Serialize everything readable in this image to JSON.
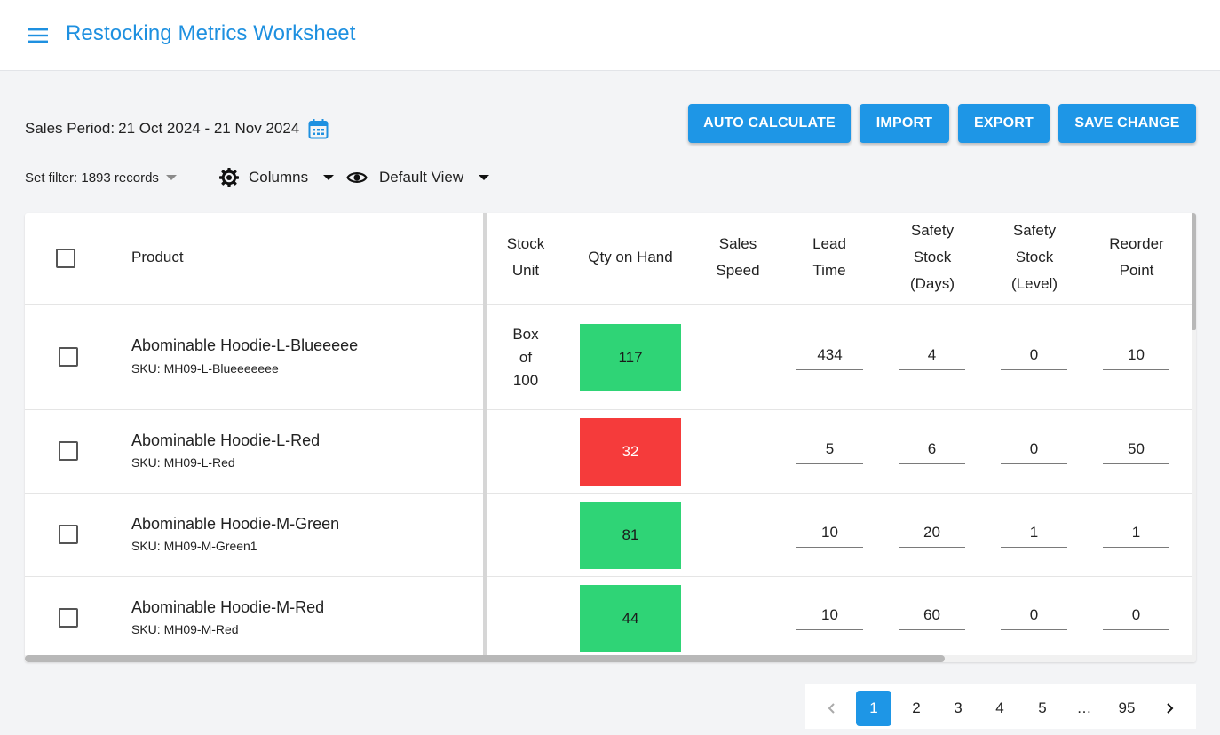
{
  "header": {
    "title": "Restocking Metrics Worksheet",
    "menu_icon": "menu-icon"
  },
  "sales_period": {
    "label": "Sales Period:",
    "value": "21 Oct 2024 - 21 Nov 2024",
    "icon": "calendar-icon"
  },
  "toolbar": {
    "auto_calculate": "AUTO CALCULATE",
    "import": "IMPORT",
    "export": "EXPORT",
    "save_change": "SAVE CHANGE"
  },
  "filters": {
    "set_filter": "Set filter: 1893 records",
    "columns": "Columns",
    "view": "Default View"
  },
  "table": {
    "headers": {
      "product": "Product",
      "stock_unit": [
        "Stock",
        "Unit"
      ],
      "qty_on_hand": "Qty on Hand",
      "sales_speed": [
        "Sales",
        "Speed"
      ],
      "lead_time": [
        "Lead",
        "Time"
      ],
      "safety_days": [
        "Safety",
        "Stock",
        "(Days)"
      ],
      "safety_level": [
        "Safety",
        "Stock",
        "(Level)"
      ],
      "reorder_point": [
        "Reorder",
        "Point"
      ]
    },
    "rows": [
      {
        "name": "Abominable Hoodie-L-Blueeeee",
        "sku": "SKU: MH09-L-Blueeeeeee",
        "unit": [
          "Box",
          "of",
          "100"
        ],
        "qty": "117",
        "qty_status": "good",
        "lead_time": "434",
        "safety_days": "4",
        "safety_level": "0",
        "reorder_point": "10"
      },
      {
        "name": "Abominable Hoodie-L-Red",
        "sku": "SKU: MH09-L-Red",
        "unit": [
          "",
          "",
          ""
        ],
        "qty": "32",
        "qty_status": "bad",
        "lead_time": "5",
        "safety_days": "6",
        "safety_level": "0",
        "reorder_point": "50"
      },
      {
        "name": "Abominable Hoodie-M-Green",
        "sku": "SKU: MH09-M-Green1",
        "unit": [
          "",
          "",
          ""
        ],
        "qty": "81",
        "qty_status": "good",
        "lead_time": "10",
        "safety_days": "20",
        "safety_level": "1",
        "reorder_point": "1"
      },
      {
        "name": "Abominable Hoodie-M-Red",
        "sku": "SKU: MH09-M-Red",
        "unit": [
          "",
          "",
          ""
        ],
        "qty": "44",
        "qty_status": "good",
        "lead_time": "10",
        "safety_days": "60",
        "safety_level": "0",
        "reorder_point": "0"
      }
    ]
  },
  "pagination": {
    "pages": [
      "1",
      "2",
      "3",
      "4",
      "5",
      "…",
      "95"
    ],
    "active": "1"
  },
  "colors": {
    "accent": "#1e96e6",
    "good": "#2fd476",
    "bad": "#f53b3b"
  }
}
